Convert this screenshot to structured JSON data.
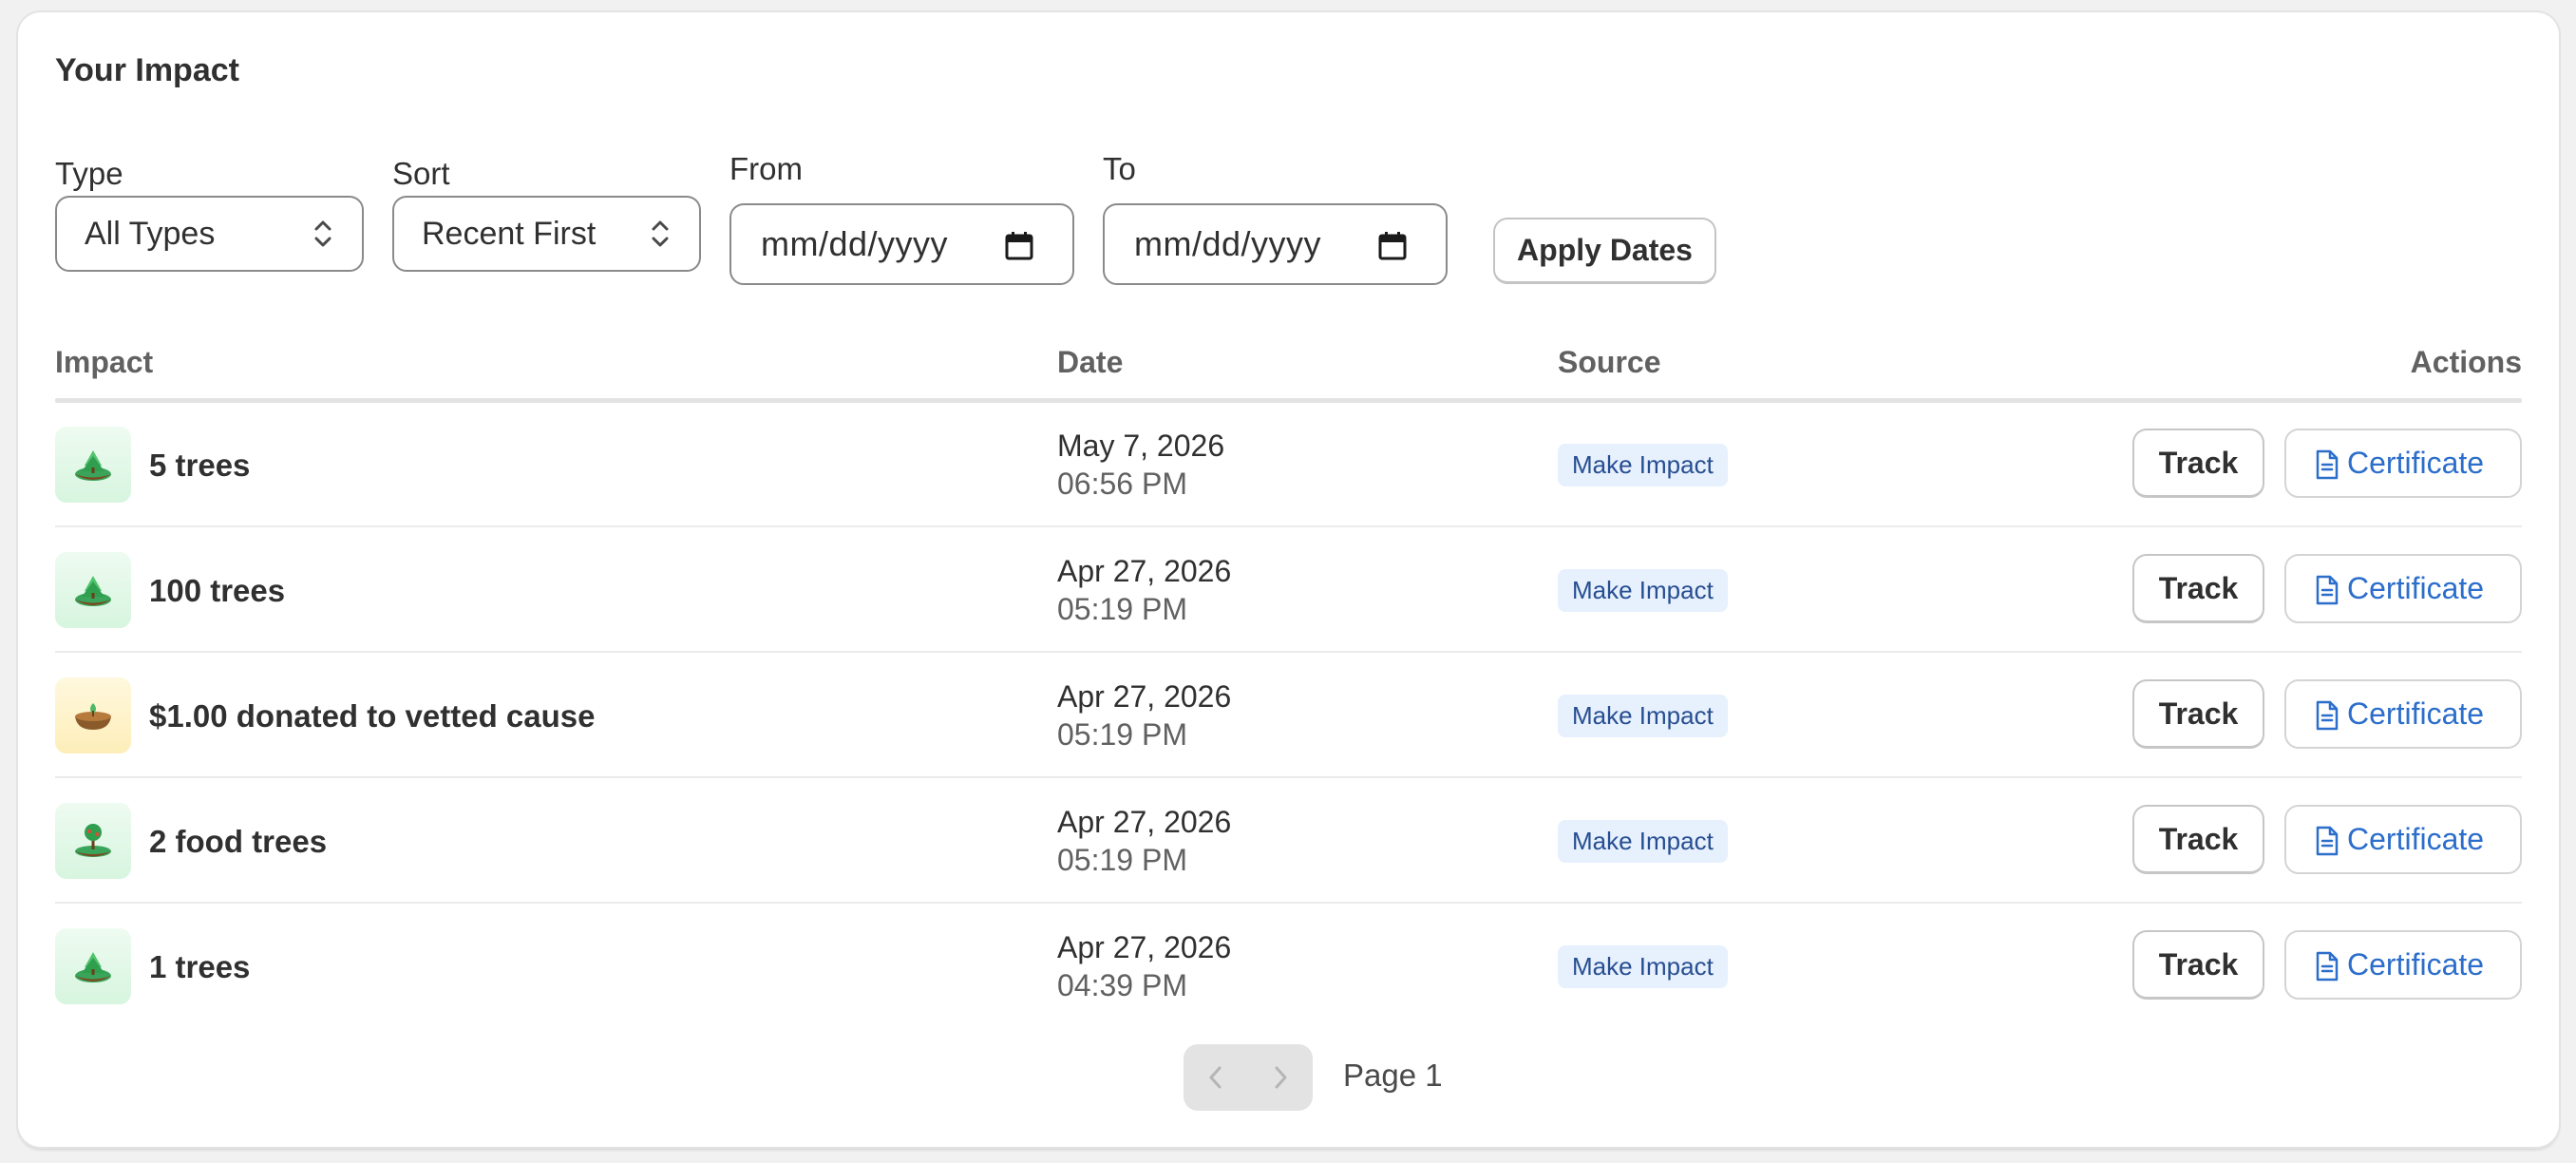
{
  "card": {
    "title": "Your Impact"
  },
  "filters": {
    "type": {
      "label": "Type",
      "value": "All Types"
    },
    "sort": {
      "label": "Sort",
      "value": "Recent First"
    },
    "from": {
      "label": "From",
      "placeholder": "mm/dd/yyyy"
    },
    "to": {
      "label": "To",
      "placeholder": "mm/dd/yyyy"
    },
    "apply_label": "Apply Dates"
  },
  "table": {
    "headers": {
      "impact": "Impact",
      "date": "Date",
      "source": "Source",
      "actions": "Actions"
    },
    "rows": [
      {
        "impact": "5 trees",
        "icon": "tree-seedling-icon",
        "tile": "green",
        "date": "May 7, 2026",
        "time": "06:56 PM",
        "source": "Make Impact",
        "track": "Track",
        "certificate": "Certificate"
      },
      {
        "impact": "100 trees",
        "icon": "tree-seedling-icon",
        "tile": "green",
        "date": "Apr 27, 2026",
        "time": "05:19 PM",
        "source": "Make Impact",
        "track": "Track",
        "certificate": "Certificate"
      },
      {
        "impact": "$1.00 donated to vetted cause",
        "icon": "donation-bowl-icon",
        "tile": "yellow",
        "date": "Apr 27, 2026",
        "time": "05:19 PM",
        "source": "Make Impact",
        "track": "Track",
        "certificate": "Certificate"
      },
      {
        "impact": "2 food trees",
        "icon": "food-tree-icon",
        "tile": "green",
        "date": "Apr 27, 2026",
        "time": "05:19 PM",
        "source": "Make Impact",
        "track": "Track",
        "certificate": "Certificate"
      },
      {
        "impact": "1 trees",
        "icon": "tree-seedling-icon",
        "tile": "green",
        "date": "Apr 27, 2026",
        "time": "04:39 PM",
        "source": "Make Impact",
        "track": "Track",
        "certificate": "Certificate"
      }
    ]
  },
  "pagination": {
    "label": "Page 1"
  },
  "colors": {
    "badge_bg": "#e7f0fd",
    "badge_text": "#264e91",
    "link": "#2c6ecb",
    "header_text": "#616161"
  }
}
